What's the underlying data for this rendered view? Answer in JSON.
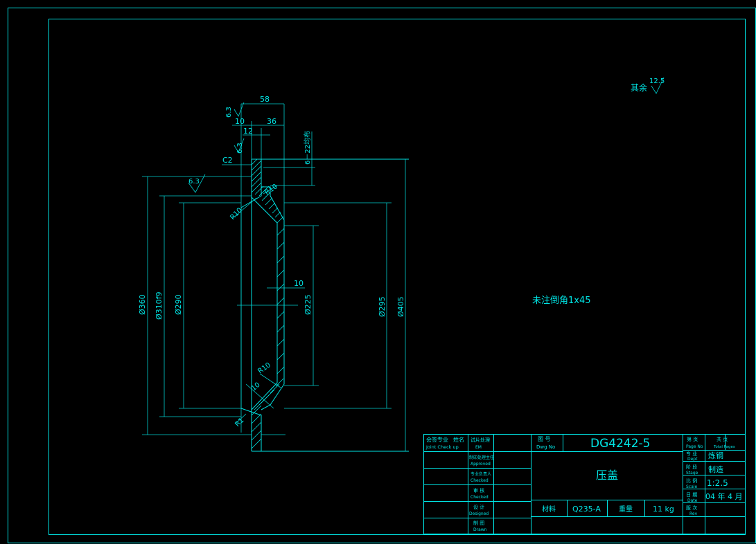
{
  "dimensions": {
    "d58": "58",
    "d36": "36",
    "d10top": "10",
    "d12": "12",
    "rough63a": "6.3",
    "rough63b": "6.3",
    "rough63c": "6.3",
    "c2": "C2",
    "holes": "6－22均布",
    "r10a": "R10",
    "r10b": "R10",
    "r10c": "R10",
    "t10": "10",
    "t10b": "10",
    "r1": "R1",
    "dia360": "Ø360",
    "dia310": "Ø310f9",
    "dia290": "Ø290",
    "dia225": "Ø225",
    "dia295": "Ø295",
    "dia405": "Ø405"
  },
  "notes": {
    "rest_label": "其余",
    "rest_value": "12.5",
    "chamfer": "未注倒角1x45"
  },
  "title_block": {
    "col1": [
      "会签专业",
      "姓名",
      "Joint Check up"
    ],
    "row_labels": [
      [
        "试片处理",
        "EM"
      ],
      [
        "制印处理主任",
        "Approved"
      ],
      [
        "专业负责人",
        "Checked"
      ],
      [
        "审  核",
        "Checked"
      ],
      [
        "设  计",
        "Designed"
      ],
      [
        "制  图",
        "Drawn"
      ]
    ],
    "dwg_no_label": [
      "图  号",
      "Dwg No"
    ],
    "dwg_no": "DG4242-5",
    "part_name": "压盖",
    "material_label": "材料",
    "material": "Q235-A",
    "weight_label": "重量",
    "weight": "11 kg",
    "page_label": [
      "第  页",
      "Page No"
    ],
    "total_label": [
      "共  页",
      "Total Pages"
    ],
    "dept_label": [
      "专  业",
      "Dept"
    ],
    "dept": "炼钢",
    "stage_label": [
      "阶  段",
      "Stage"
    ],
    "stage": "制造",
    "scale_label": [
      "比  例",
      "Scale"
    ],
    "scale": "1:2.5",
    "date_label": [
      "日  期",
      "Date"
    ],
    "date": "04 年 4 月",
    "rev_label": [
      "版  次",
      "Rev"
    ]
  }
}
